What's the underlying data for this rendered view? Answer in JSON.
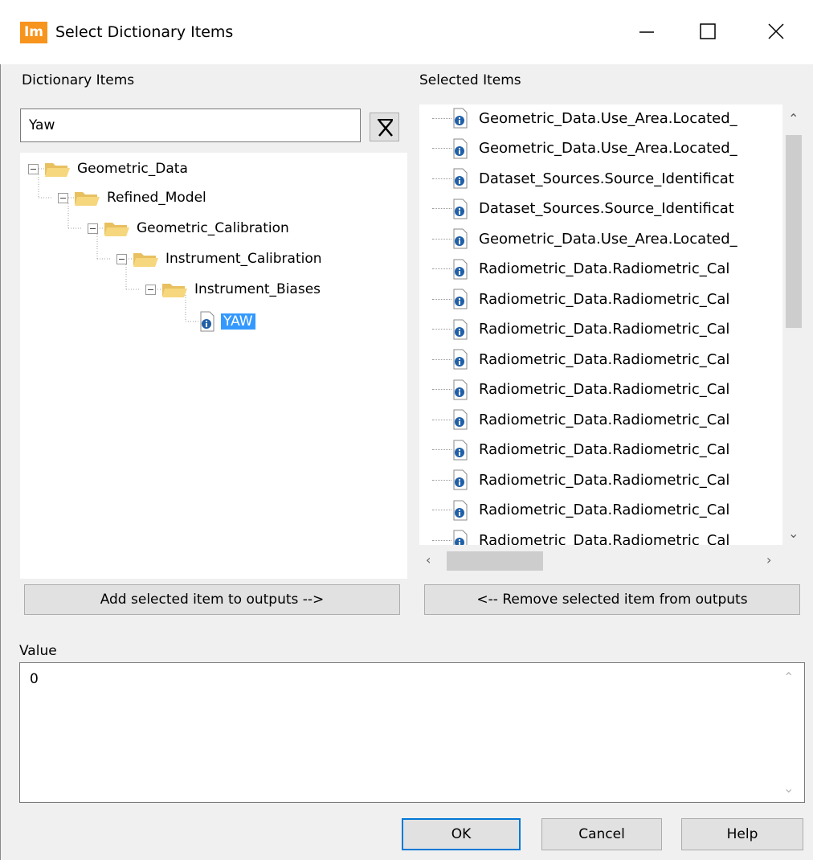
{
  "window": {
    "app_icon_text": "Im",
    "title": "Select Dictionary Items"
  },
  "left_panel": {
    "heading": "Dictionary Items",
    "search_value": "Yaw",
    "tree": [
      {
        "label": "Geometric_Data",
        "level": 0,
        "type": "folder"
      },
      {
        "label": "Refined_Model",
        "level": 1,
        "type": "folder"
      },
      {
        "label": "Geometric_Calibration",
        "level": 2,
        "type": "folder"
      },
      {
        "label": "Instrument_Calibration",
        "level": 3,
        "type": "folder"
      },
      {
        "label": "Instrument_Biases",
        "level": 4,
        "type": "folder"
      },
      {
        "label": "YAW",
        "level": 5,
        "type": "item",
        "selected": true
      }
    ],
    "add_button": "Add selected item to outputs -->"
  },
  "right_panel": {
    "heading": "Selected Items",
    "items": [
      "Geometric_Data.Use_Area.Located_",
      "Geometric_Data.Use_Area.Located_",
      "Dataset_Sources.Source_Identificat",
      "Dataset_Sources.Source_Identificat",
      "Geometric_Data.Use_Area.Located_",
      "Radiometric_Data.Radiometric_Cal",
      "Radiometric_Data.Radiometric_Cal",
      "Radiometric_Data.Radiometric_Cal",
      "Radiometric_Data.Radiometric_Cal",
      "Radiometric_Data.Radiometric_Cal",
      "Radiometric_Data.Radiometric_Cal",
      "Radiometric_Data.Radiometric_Cal",
      "Radiometric_Data.Radiometric_Cal",
      "Radiometric_Data.Radiometric_Cal",
      "Radiometric_Data.Radiometric_Cal"
    ],
    "remove_button": "<-- Remove selected item from outputs"
  },
  "value": {
    "label": "Value",
    "text": "0"
  },
  "footer": {
    "ok": "OK",
    "cancel": "Cancel",
    "help": "Help"
  },
  "colors": {
    "selection": "#3399ff",
    "app_icon": "#f7941d",
    "default_button_border": "#0078d7"
  }
}
